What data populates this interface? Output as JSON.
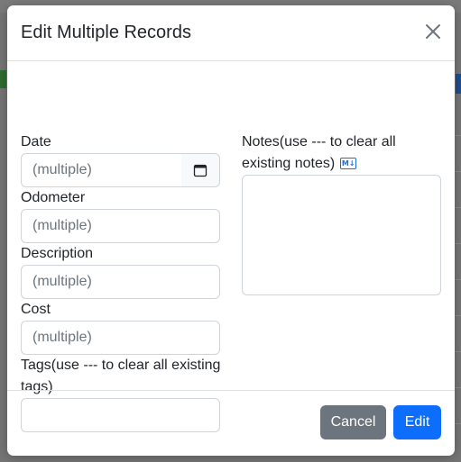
{
  "modal": {
    "title": "Edit Multiple Records",
    "fields": {
      "date_label": "Date",
      "date_placeholder": "(multiple)",
      "odometer_label": "Odometer",
      "odometer_placeholder": "(multiple)",
      "description_label": "Description",
      "description_placeholder": "(multiple)",
      "cost_label": "Cost",
      "cost_placeholder": "(multiple)",
      "tags_label_line1": "Tags(use --- to clear all existing",
      "tags_label_line2": "tags)",
      "tags_value": "",
      "notes_label_line1": "Notes(use --- to clear all",
      "notes_label_line2": "existing notes)",
      "notes_value": "",
      "markdown_badge": "M↓"
    },
    "footer": {
      "cancel_label": "Cancel",
      "edit_label": "Edit"
    }
  },
  "icons": {
    "close": "close-icon",
    "calendar": "calendar-icon",
    "markdown": "markdown-icon"
  },
  "colors": {
    "primary": "#0d6efd",
    "secondary": "#6c757d",
    "overlay": "#757575"
  }
}
